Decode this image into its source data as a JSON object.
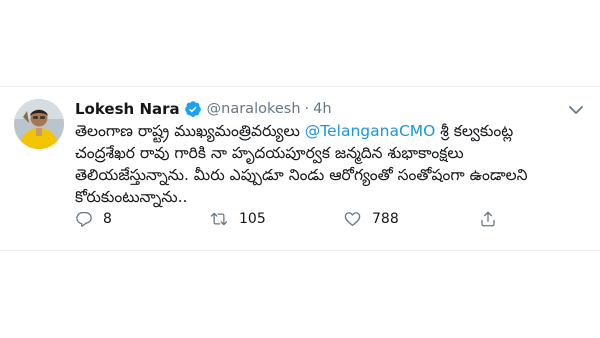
{
  "tweet": {
    "author": {
      "display_name": "Lokesh Nara",
      "handle": "@naralokesh",
      "verified": true,
      "avatar_icon": "avatar-photo"
    },
    "separator": "·",
    "time": "4h",
    "text_before_mention": "తెలంగాణ రాష్ట్ర ముఖ్యమంత్రివర్యులు ",
    "mention": "@TelanganaCMO",
    "text_after_mention": " శ్రీ కల్వకుంట్ల చంద్రశేఖర రావు గారికి నా హృదయపూర్వక జన్మదిన శుభాకాంక్షలు తెలియజేస్తున్నాను. మీరు ఎప్పుడూ నిండు ఆరోగ్యంతో సంతోషంగా ఉండాలని కోరుకుంటున్నాను..",
    "actions": {
      "reply": {
        "icon": "reply-icon",
        "count": "8"
      },
      "retweet": {
        "icon": "retweet-icon",
        "count": "105"
      },
      "like": {
        "icon": "heart-icon",
        "count": "788"
      },
      "share": {
        "icon": "share-icon"
      }
    }
  },
  "colors": {
    "accent": "#1b95e0",
    "verified": "#1da1f2",
    "muted": "#657786",
    "text": "#14171a"
  }
}
